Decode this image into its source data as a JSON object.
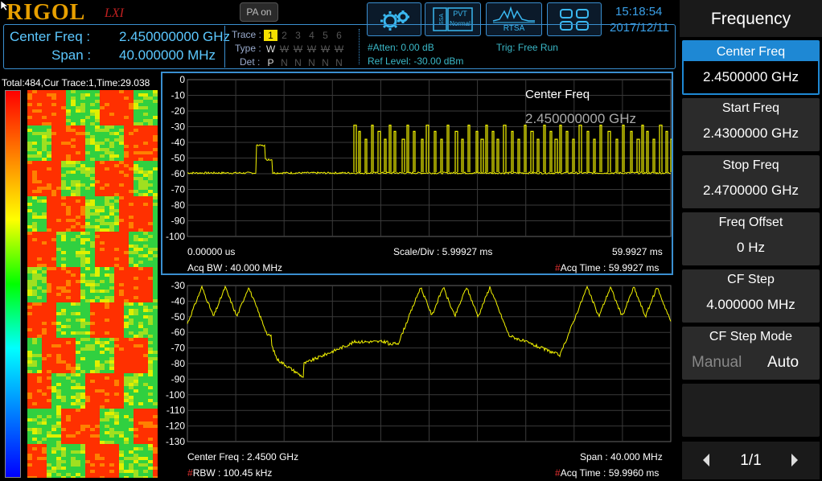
{
  "header": {
    "brand": "RIGOL",
    "lxi": "LXI",
    "pa_button": "PA on",
    "pvt_label": "PVT",
    "pvt_sub": "Normal",
    "rtsa_label": "RTSA",
    "time": "15:18:54",
    "date": "2017/12/11"
  },
  "info": {
    "center_freq_label": "Center Freq :",
    "center_freq_value": "2.450000000 GHz",
    "span_label": "Span :",
    "span_value": "40.000000 MHz",
    "trace_label": "Trace :",
    "type_label": "Type :",
    "det_label": "Det :",
    "traces": [
      "1",
      "2",
      "3",
      "4",
      "5",
      "6"
    ],
    "types": [
      "W",
      "W",
      "W",
      "W",
      "W",
      "W"
    ],
    "dets": [
      "P",
      "N",
      "N",
      "N",
      "N",
      "N"
    ],
    "atten": "#Atten: 0.00 dB",
    "ref_level": "Ref Level: -30.00 dBm",
    "trig": "Trig: Free Run"
  },
  "waterfall": {
    "header": "Total:484,Cur Trace:1,Time:29.038"
  },
  "upper_plot": {
    "y_ticks": [
      "0",
      "-10",
      "-20",
      "-30",
      "-40",
      "-50",
      "-60",
      "-70",
      "-80",
      "-90",
      "-100"
    ],
    "marker_label": "Center Freq",
    "marker_value": "2.450000000 GHz",
    "x_start": "0.00000 us",
    "scale_div": "Scale/Div : 5.99927 ms",
    "x_stop": "59.9927 ms",
    "acq_bw": "Acq BW : 40.000 MHz",
    "acq_time_hash": "#",
    "acq_time": "Acq Time : 59.9927 ms",
    "trace_color": "#f5f500"
  },
  "lower_plot": {
    "y_ticks": [
      "-30",
      "-40",
      "-50",
      "-60",
      "-70",
      "-80",
      "-90",
      "-100",
      "-110",
      "-120",
      "-130"
    ],
    "center_freq": "Center Freq : 2.4500 GHz",
    "span": "Span : 40.000 MHz",
    "rbw_hash": "#",
    "rbw": "RBW : 100.45 kHz",
    "acq_time_hash": "#",
    "acq_time": "Acq Time : 59.9960 ms"
  },
  "menu": {
    "title": "Frequency",
    "items": [
      {
        "label": "Center Freq",
        "value": "2.4500000 GHz"
      },
      {
        "label": "Start Freq",
        "value": "2.4300000 GHz"
      },
      {
        "label": "Stop Freq",
        "value": "2.4700000 GHz"
      },
      {
        "label": "Freq Offset",
        "value": "0 Hz"
      },
      {
        "label": "CF Step",
        "value": "4.000000 MHz"
      },
      {
        "label": "CF Step Mode",
        "opt_manual": "Manual",
        "opt_auto": "Auto"
      }
    ],
    "page": "1/1"
  },
  "colors": {
    "accent": "#3a8fd0",
    "selected_menu": "#1e88d4",
    "trace": "#f5f500",
    "brand": "#e8a000"
  }
}
